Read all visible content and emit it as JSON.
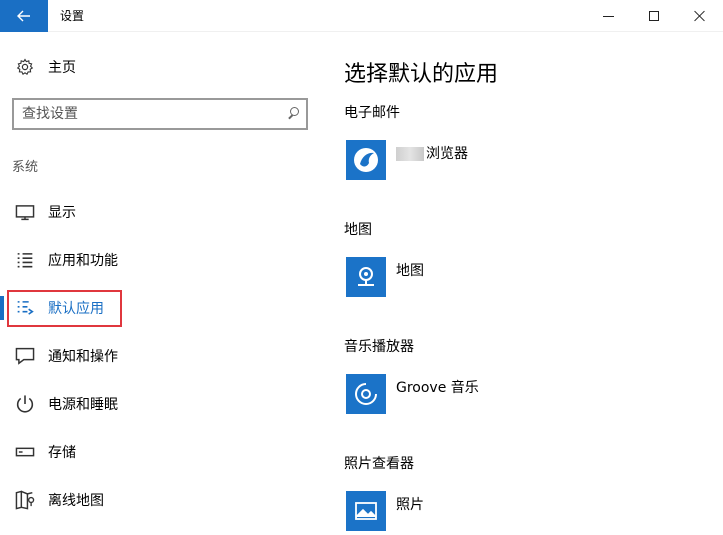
{
  "window": {
    "title": "设置",
    "back_icon": "arrow-left-icon",
    "controls": {
      "minimize": "minimize-icon",
      "maximize": "maximize-icon",
      "close": "close-icon"
    }
  },
  "sidebar": {
    "home": {
      "label": "主页",
      "icon": "gear-icon"
    },
    "search": {
      "placeholder": "查找设置",
      "icon": "search-icon"
    },
    "section": "系统",
    "items": [
      {
        "label": "显示",
        "icon": "monitor-icon"
      },
      {
        "label": "应用和功能",
        "icon": "list-icon"
      },
      {
        "label": "默认应用",
        "icon": "default-apps-icon",
        "active": true
      },
      {
        "label": "通知和操作",
        "icon": "notification-icon"
      },
      {
        "label": "电源和睡眠",
        "icon": "power-icon"
      },
      {
        "label": "存储",
        "icon": "storage-icon"
      },
      {
        "label": "离线地图",
        "icon": "map-icon"
      }
    ]
  },
  "main": {
    "title": "选择默认的应用",
    "categories": [
      {
        "label": "电子邮件",
        "app": "浏览器",
        "icon": "browser-app-icon"
      },
      {
        "label": "地图",
        "app": "地图",
        "icon": "maps-app-icon"
      },
      {
        "label": "音乐播放器",
        "app": "Groove 音乐",
        "icon": "groove-music-icon"
      },
      {
        "label": "照片查看器",
        "app": "照片",
        "icon": "photos-app-icon"
      }
    ]
  },
  "colors": {
    "accent": "#1a6fc4",
    "tile": "#1b73c8",
    "highlight": "#e0373e"
  }
}
